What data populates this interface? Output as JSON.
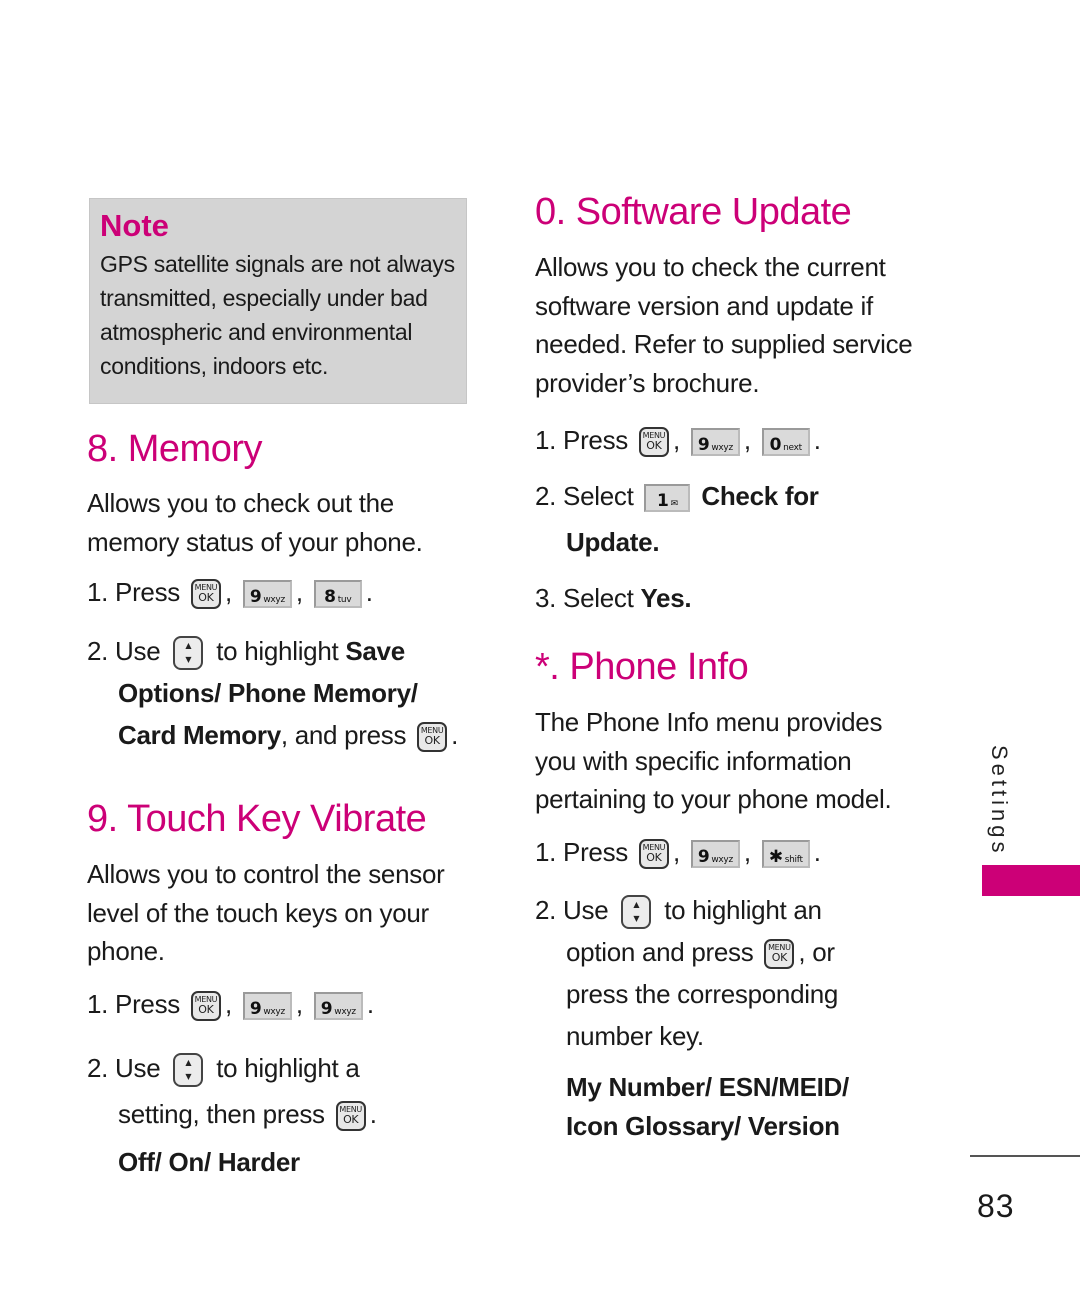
{
  "note": {
    "title": "Note",
    "lines": [
      "GPS satellite signals are not always",
      "transmitted, especially under bad",
      "atmospheric and environmental",
      "conditions, indoors etc."
    ]
  },
  "memory": {
    "title": "8. Memory",
    "desc": [
      "Allows you to check out the",
      "memory status of your phone."
    ],
    "step1": {
      "num": "1.",
      "text": "Press",
      "keys": [
        "MENU/OK",
        "9 wxyz",
        "8 tuv"
      ]
    },
    "step2": {
      "num": "2.",
      "use": "Use",
      "text": "to highlight",
      "opt1": "Save",
      "opt2": "Options/ Phone Memory/",
      "opt3": "Card Memory",
      "tail": ", and press"
    }
  },
  "touch_key": {
    "title": "9. Touch Key Vibrate",
    "desc": [
      "Allows you to control the sensor",
      "level of the touch keys on your",
      "phone."
    ],
    "step1": {
      "num": "1.",
      "text": "Press",
      "keys": [
        "MENU/OK",
        "9 wxyz",
        "9 wxyz"
      ]
    },
    "step2": {
      "num": "2.",
      "use": "Use",
      "text": "to highlight a",
      "line2": "setting, then press"
    },
    "options": "Off/ On/ Harder"
  },
  "software_update": {
    "title": "0. Software Update",
    "desc": [
      "Allows you to check the current",
      "software version and update if",
      "needed. Refer to supplied service",
      "provider’s brochure."
    ],
    "step1": {
      "num": "1.",
      "text": "Press",
      "keys": [
        "MENU/OK",
        "9 wxyz",
        "0 next"
      ]
    },
    "step2": {
      "num": "2.",
      "text": "Select",
      "key": "1",
      "opt1": "Check for",
      "opt2": "Update."
    },
    "step3": {
      "num": "3.",
      "text": "Select",
      "opt": "Yes."
    }
  },
  "phone_info": {
    "title": "*. Phone Info",
    "desc": [
      "The Phone Info menu provides",
      "you with specific information",
      "pertaining to your phone model."
    ],
    "step1": {
      "num": "1.",
      "text": "Press",
      "keys": [
        "MENU/OK",
        "9 wxyz",
        "* shift"
      ]
    },
    "step2": {
      "num": "2.",
      "use": "Use",
      "text": "to highlight an",
      "line2": "option and press",
      "line2_tail": ", or",
      "line3": "press the corresponding",
      "line4": "number key."
    },
    "options": [
      "My Number/ ESN/MEID/",
      "Icon Glossary/ Version"
    ]
  },
  "keys": {
    "menu_top": "MENU",
    "menu_bottom": "OK",
    "nine": "9",
    "nine_sub": "wxyz",
    "eight": "8",
    "eight_sub": "tuv",
    "zero": "0",
    "zero_sub": "next",
    "one": "1",
    "one_sub": "✉",
    "star": "✱",
    "star_sub": "shift",
    "nav_up": "▲",
    "nav_down": "▼"
  },
  "punct": {
    "comma": ",",
    "period": "."
  },
  "side": {
    "label": "Settings",
    "accent": "#cc0077"
  },
  "page_number": "83"
}
